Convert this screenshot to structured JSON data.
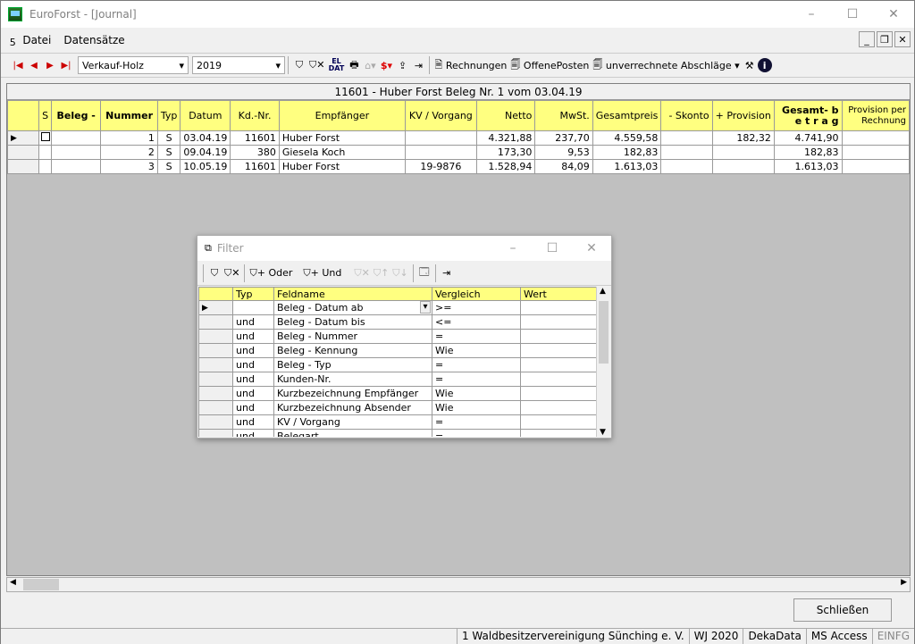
{
  "window": {
    "title": "EuroForst - [Journal]",
    "minimize": "–",
    "maximize": "☐",
    "close": "✕"
  },
  "menu": {
    "items": [
      "Datei",
      "Datensätze"
    ]
  },
  "toolbar": {
    "category": "Verkauf-Holz",
    "year": "2019",
    "eldat": "EL DAT",
    "buttons": [
      "Rechnungen",
      "OffenePosten",
      "unverrechnete Abschläge"
    ]
  },
  "grid": {
    "caption": "11601  -  Huber Forst     Beleg Nr. 1   vom 03.04.19",
    "headers": [
      "S",
      "Beleg -",
      "Nummer",
      "Typ",
      "Datum",
      "Kd.-Nr.",
      "Empfänger",
      "KV / Vorgang",
      "Netto",
      "MwSt.",
      "Gesamtpreis",
      "- Skonto",
      "+ Provision",
      "Gesamt- b e t r a g",
      "Provision per Rechnung"
    ],
    "rows": [
      [
        "",
        "",
        "1",
        "S",
        "03.04.19",
        "11601",
        "Huber Forst",
        "",
        "4.321,88",
        "237,70",
        "4.559,58",
        "",
        "182,32",
        "4.741,90",
        ""
      ],
      [
        "",
        "",
        "2",
        "S",
        "09.04.19",
        "380",
        "Giesela Koch",
        "",
        "173,30",
        "9,53",
        "182,83",
        "",
        "",
        "182,83",
        ""
      ],
      [
        "",
        "",
        "3",
        "S",
        "10.05.19",
        "11601",
        "Huber Forst",
        "19-9876",
        "1.528,94",
        "84,09",
        "1.613,03",
        "",
        "",
        "1.613,03",
        ""
      ]
    ]
  },
  "filter": {
    "title": "Filter",
    "oder": "Oder",
    "und": "Und",
    "headers": [
      "Typ",
      "Feldname",
      "Vergleich",
      "Wert"
    ],
    "rows": [
      [
        "",
        "Beleg - Datum  ab",
        ">=",
        ""
      ],
      [
        "und",
        "Beleg - Datum  bis",
        "<=",
        ""
      ],
      [
        "und",
        "Beleg - Nummer",
        "=",
        ""
      ],
      [
        "und",
        "Beleg - Kennung",
        "Wie",
        ""
      ],
      [
        "und",
        "Beleg - Typ",
        "=",
        ""
      ],
      [
        "und",
        "Kunden-Nr.",
        "=",
        ""
      ],
      [
        "und",
        "Kurzbezeichnung Empfänger",
        "Wie",
        ""
      ],
      [
        "und",
        "Kurzbezeichnung Absender",
        "Wie",
        ""
      ],
      [
        "und",
        "KV / Vorgang",
        "=",
        ""
      ],
      [
        "und",
        "Belegart",
        "=",
        ""
      ]
    ]
  },
  "close_button": "Schließen",
  "status": [
    "1 Waldbesitzervereinigung Sünching e. V.",
    "WJ 2020",
    "DekaData",
    "MS Access",
    "EINFG"
  ]
}
